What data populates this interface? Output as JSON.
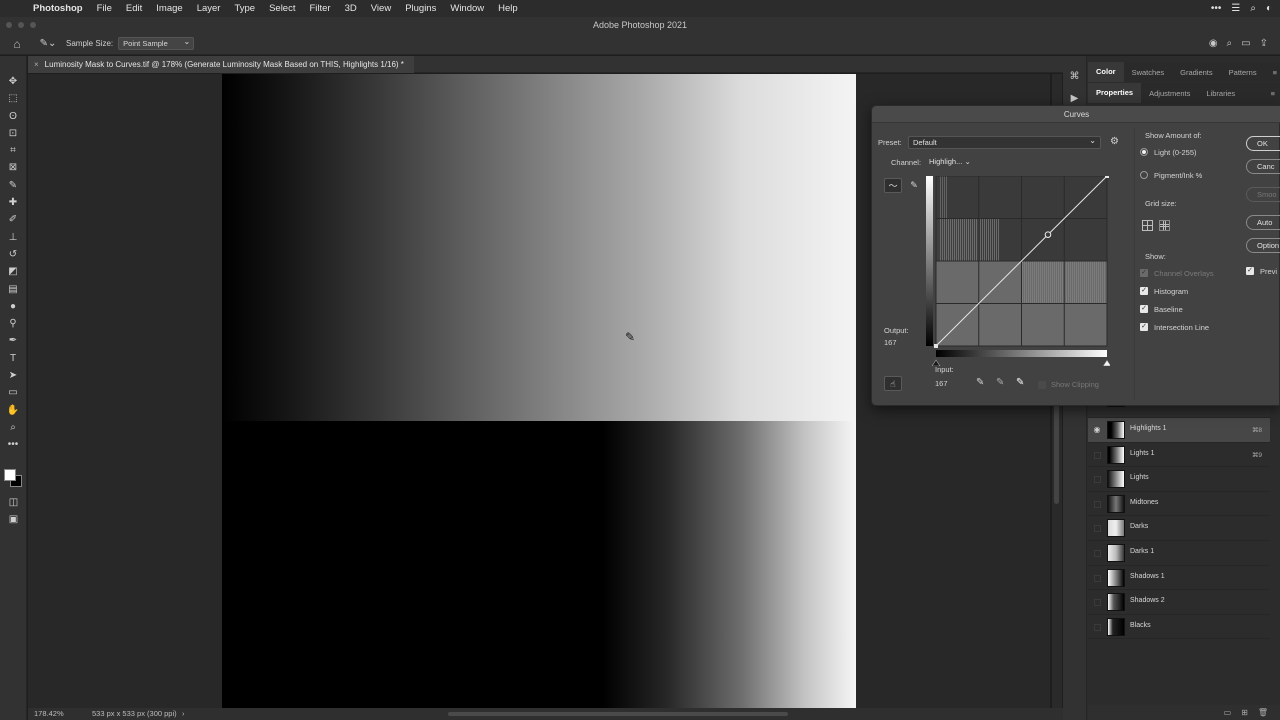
{
  "menubar": {
    "items": [
      "Photoshop",
      "File",
      "Edit",
      "Image",
      "Layer",
      "Type",
      "Select",
      "Filter",
      "3D",
      "View",
      "Plugins",
      "Window",
      "Help"
    ]
  },
  "window": {
    "title": "Adobe Photoshop 2021"
  },
  "options": {
    "sample_size_label": "Sample Size:",
    "sample_size_value": "Point Sample"
  },
  "document": {
    "tab_title": "Luminosity Mask to Curves.tif @ 178% (Generate Luminosity Mask Based on THIS, Highlights 1/16) *",
    "zoom": "178.42%",
    "doc_info": "533 px x 533 px (300 ppi)"
  },
  "panels": {
    "top_tabs": [
      "Color",
      "Swatches",
      "Gradients",
      "Patterns"
    ],
    "second_tabs": [
      "Properties",
      "Adjustments",
      "Libraries"
    ]
  },
  "curves": {
    "title": "Curves",
    "preset_label": "Preset:",
    "preset_value": "Default",
    "channel_label": "Channel:",
    "channel_value": "Highligh...",
    "output_label": "Output:",
    "output_value": "167",
    "input_label": "Input:",
    "input_value": "167",
    "show_clipping": "Show Clipping",
    "show_amount_label": "Show Amount of:",
    "light_option": "Light  (0-255)",
    "pigment_option": "Pigment/Ink %",
    "grid_size_label": "Grid size:",
    "show_label": "Show:",
    "channel_overlays": "Channel Overlays",
    "histogram": "Histogram",
    "baseline": "Baseline",
    "intersection_line": "Intersection Line",
    "buttons": {
      "ok": "OK",
      "cancel": "Canc",
      "smooth": "Smoo",
      "auto": "Auto",
      "options": "Option"
    },
    "preview": "Previ",
    "curve_points": [
      [
        0,
        0
      ],
      [
        167,
        167
      ],
      [
        255,
        255
      ]
    ]
  },
  "layers": [
    {
      "name": "Highlights 1",
      "shortcut": "⌘8",
      "visible": true,
      "selected": true
    },
    {
      "name": "Lights 1",
      "shortcut": "⌘9",
      "visible": false,
      "selected": false
    },
    {
      "name": "Lights",
      "shortcut": "",
      "visible": false,
      "selected": false
    },
    {
      "name": "Midtones",
      "shortcut": "",
      "visible": false,
      "selected": false
    },
    {
      "name": "Darks",
      "shortcut": "",
      "visible": false,
      "selected": false
    },
    {
      "name": "Darks 1",
      "shortcut": "",
      "visible": false,
      "selected": false
    },
    {
      "name": "Shadows 1",
      "shortcut": "",
      "visible": false,
      "selected": false
    },
    {
      "name": "Shadows 2",
      "shortcut": "",
      "visible": false,
      "selected": false
    },
    {
      "name": "Blacks",
      "shortcut": "",
      "visible": false,
      "selected": false
    }
  ],
  "icons": {
    "apple": "apple-icon",
    "home": "home-icon",
    "eyedropper": "eyedropper-icon",
    "search": "search-icon",
    "gear": "gear-icon",
    "eye": "eye-icon"
  }
}
